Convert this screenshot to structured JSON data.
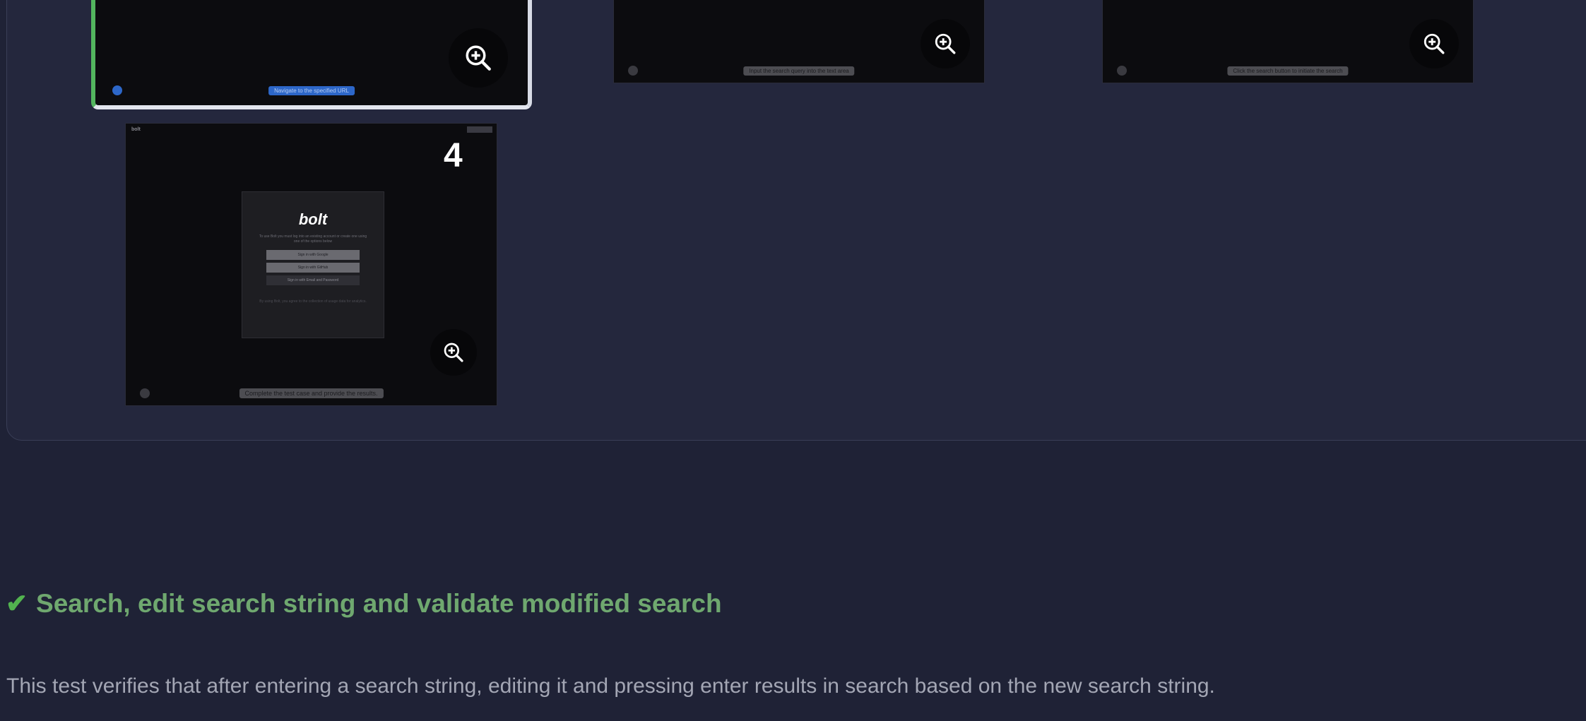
{
  "screenshots": [
    {
      "caption": "Navigate to the specified URL",
      "active": true
    },
    {
      "caption": "Input the search query into the text area",
      "active": false
    },
    {
      "caption": "Click the search button to initiate the search",
      "active": false
    },
    {
      "step_number": "4",
      "caption": "Complete the test case and provide the results.",
      "active": false,
      "brand": "bolt",
      "modal_logo": "bolt",
      "modal_text": "To use Bolt you must log into an existing account or create one using one of the options below",
      "modal_buttons": [
        "Sign in with Google",
        "Sign in with GitHub",
        "Sign in with Email and Password"
      ],
      "modal_footer": "By using Bolt, you agree to the collection of usage data for analytics."
    }
  ],
  "test": {
    "check_symbol": "✔",
    "title": "Search, edit search string and validate modified search",
    "description": "This test verifies that after entering a search string, editing it and pressing enter results in search based on the new search string."
  },
  "colors": {
    "pass_green": "#52b34f",
    "active_border": "#53b55e",
    "background": "#1f2236"
  }
}
